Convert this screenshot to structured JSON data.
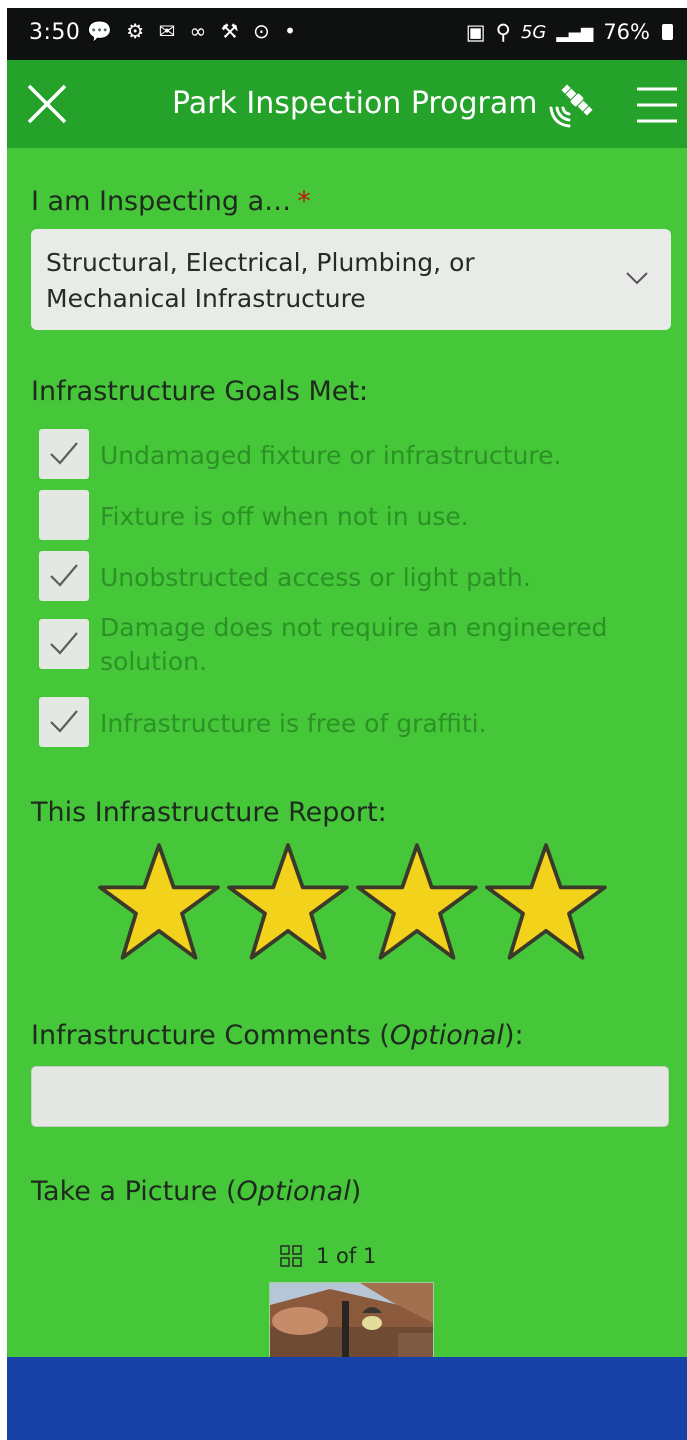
{
  "status_bar": {
    "time": "3:50",
    "notification_icons": "💬 ⚙ ✉ ∞ ⚒ ⊙ •",
    "network": "5G",
    "battery": "76%"
  },
  "app_bar": {
    "title": "Park Inspection Program",
    "icons": [
      "close-icon",
      "satellite-gps-icon",
      "menu-icon"
    ]
  },
  "form": {
    "inspecting": {
      "label": "I am Inspecting a…",
      "required_marker": "*",
      "selected_value": "Structural, Electrical, Plumbing, or Mechanical Infrastructure"
    },
    "goals": {
      "label": "Infrastructure Goals Met:",
      "items": [
        {
          "label": "Undamaged fixture or infrastructure.",
          "checked": true
        },
        {
          "label": "Fixture is off when not in use.",
          "checked": false
        },
        {
          "label": "Unobstructed access or light path.",
          "checked": true
        },
        {
          "label": "Damage does not require an engineered solution.",
          "checked": true
        },
        {
          "label": "Infrastructure is free of graffiti.",
          "checked": true
        }
      ]
    },
    "rating": {
      "label": "This Infrastructure Report:",
      "stars_shown": 4,
      "star_color": "#f2d21b"
    },
    "comments": {
      "label_main": "Infrastructure Comments (",
      "label_italic": "Optional",
      "label_end": "):",
      "value": ""
    },
    "picture": {
      "label_main": "Take a Picture (",
      "label_italic": "Optional",
      "label_end": ")",
      "pager": "1 of 1"
    }
  },
  "colors": {
    "background": "#45c739",
    "app_bar": "#24a22a",
    "bottom_bar": "#1942a8",
    "checkbox_label": "#2c9226"
  }
}
